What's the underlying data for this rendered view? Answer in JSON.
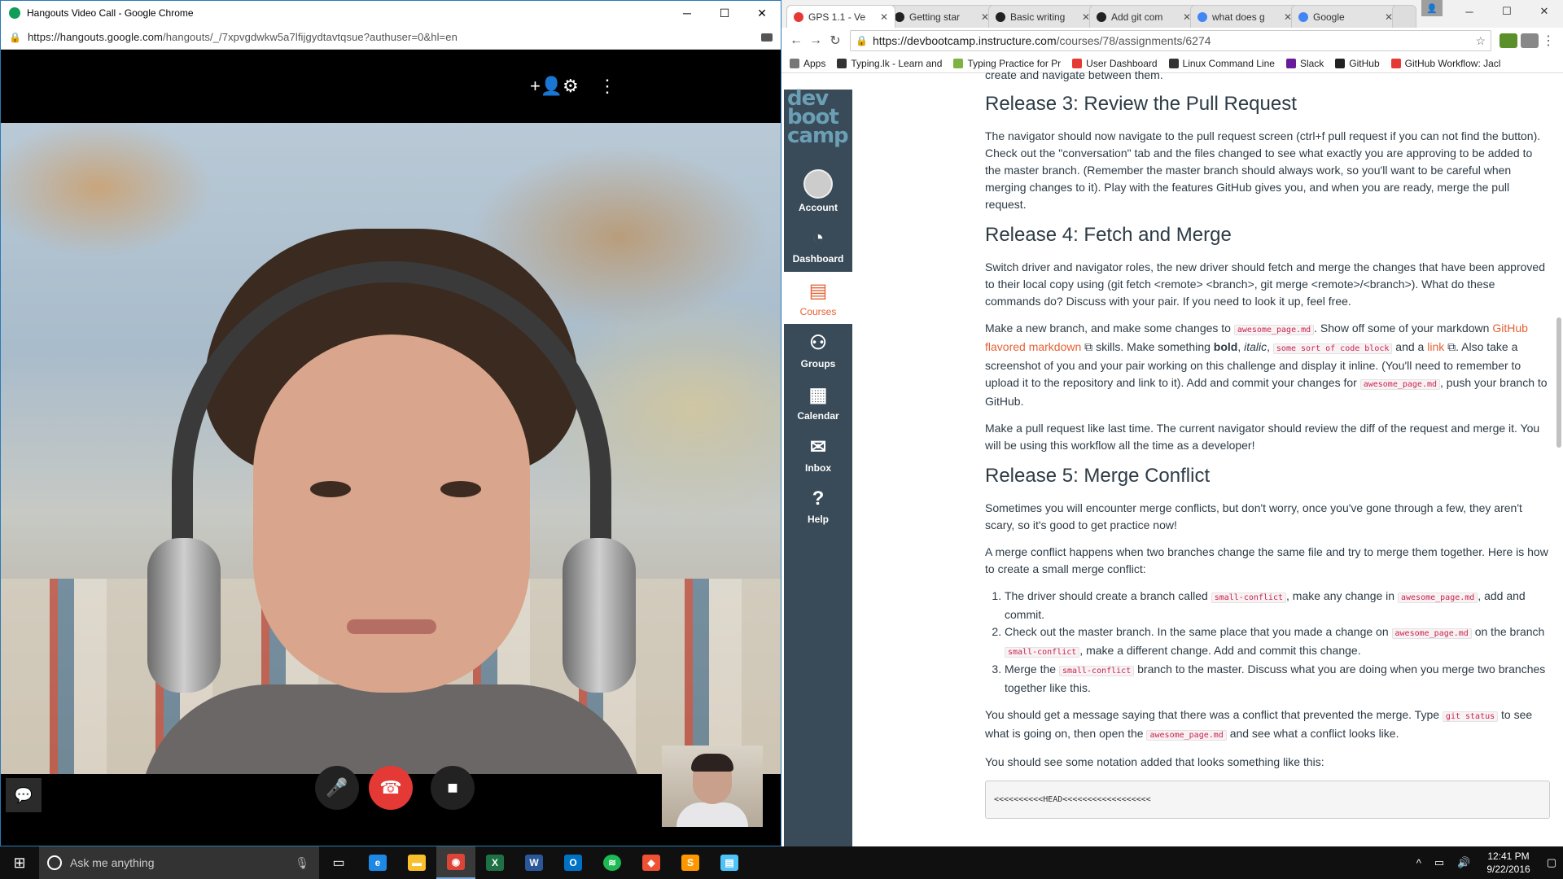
{
  "hangouts": {
    "window_title": "Hangouts Video Call - Google Chrome",
    "url_host": "https://hangouts.google.com",
    "url_path": "/hangouts/_/7xpvgdwkw5a7lfijgydtavtqsue?authuser=0&hl=en",
    "add_person_icon": "+👤",
    "settings_icon": "⚙",
    "more_icon": "⋮",
    "chat_icon": "💬",
    "mic_icon": "🎤",
    "end_call_icon": "☎",
    "camera_icon": "■"
  },
  "chrome": {
    "tabs": [
      {
        "label": "GPS 1.1 - Ve",
        "color": "#e53935"
      },
      {
        "label": "Getting star",
        "color": "#222222"
      },
      {
        "label": "Basic writing",
        "color": "#222222"
      },
      {
        "label": "Add git com",
        "color": "#222222"
      },
      {
        "label": "what does g",
        "color": "#4285f4"
      },
      {
        "label": "Google",
        "color": "#4285f4"
      }
    ],
    "url_host": "https://devbootcamp.instructure.com",
    "url_path": "/courses/78/assignments/6274",
    "bookmarks": [
      {
        "label": "Apps",
        "color": "#777777"
      },
      {
        "label": "Typing.lk - Learn and",
        "color": "#333333"
      },
      {
        "label": "Typing Practice for Pr",
        "color": "#7cb342"
      },
      {
        "label": "User Dashboard",
        "color": "#e53935"
      },
      {
        "label": "Linux Command Line",
        "color": "#333333"
      },
      {
        "label": "Slack",
        "color": "#6a1b9a"
      },
      {
        "label": "GitHub",
        "color": "#222222"
      },
      {
        "label": "GitHub Workflow: Jacl",
        "color": "#e53935"
      }
    ]
  },
  "canvas_nav": {
    "logo": [
      "dev",
      "boot",
      "camp"
    ],
    "items": [
      {
        "label": "Account",
        "icon": "◯"
      },
      {
        "label": "Dashboard",
        "icon": "◔"
      },
      {
        "label": "Courses",
        "icon": "▤"
      },
      {
        "label": "Groups",
        "icon": "⚇"
      },
      {
        "label": "Calendar",
        "icon": "▦"
      },
      {
        "label": "Inbox",
        "icon": "✉"
      },
      {
        "label": "Help",
        "icon": "?"
      }
    ]
  },
  "content": {
    "top_fragment": "create and navigate between them.",
    "r3_title": "Release 3: Review the Pull Request",
    "r3_p": "The navigator should now navigate to the pull request screen (ctrl+f pull request if you can not find the button). Check out the \"conversation\" tab and the files changed to see what exactly you are approving to be added to the master branch. (Remember the master branch should always work, so you'll want to be careful when merging changes to it). Play with the features GitHub gives you, and when you are ready, merge the pull request.",
    "r4_title": "Release 4: Fetch and Merge",
    "r4_p1": "Switch driver and navigator roles, the new driver should fetch and merge the changes that have been approved to their local copy using (git fetch <remote> <branch>, git merge <remote>/<branch>). What do these commands do? Discuss with your pair. If you need to look it up, feel free.",
    "r4_p2_a": "Make a new branch, and make some changes to",
    "file_name": "awesome_page.md",
    "r4_p2_b": ". Show off some of your markdown",
    "gfm_link": "GitHub flavored markdown",
    "r4_p2_c": "skills. Make something",
    "bold": "bold",
    "italic": "italic",
    "code_block": "some sort of code block",
    "r4_p2_d": "and a",
    "link_word": "link",
    "r4_p2_e": ". Also take a screenshot of you and your pair working on this challenge and display it inline. (You'll need to remember to upload it to the repository and link to it). Add and commit your changes for",
    "r4_p2_f": ", push your branch to GitHub.",
    "r4_p3": "Make a pull request like last time. The current navigator should review the diff of the request and merge it. You will be using this workflow all the time as a developer!",
    "r5_title": "Release 5: Merge Conflict",
    "r5_p1": "Sometimes you will encounter merge conflicts, but don't worry, once you've gone through a few, they aren't scary, so it's good to get practice now!",
    "r5_p2": "A merge conflict happens when two branches change the same file and try to merge them together. Here is how to create a small merge conflict:",
    "small_conflict": "small-conflict",
    "li1_a": "The driver should create a branch called",
    "li1_b": ", make any change in",
    "li1_c": ", add and commit.",
    "li2_a": "Check out the master branch. In the same place that you made a change on",
    "li2_b": "on the branch",
    "li2_c": ", make a different change. Add and commit this change.",
    "li3_a": "Merge the",
    "li3_b": "branch to the master. Discuss what you are doing when you merge two branches together like this.",
    "r5_p3_a": "You should get a message saying that there was a conflict that prevented the merge. Type",
    "git_status": "git status",
    "r5_p3_b": "to see what is going on, then open the",
    "r5_p3_c": "and see what a conflict looks like.",
    "r5_p4": "You should see some notation added that looks something like this:",
    "pre": "<<<<<<<<<<HEAD<<<<<<<<<<<<<<<<<<"
  },
  "taskbar": {
    "search_placeholder": "Ask me anything",
    "apps": [
      {
        "name": "task-view",
        "glyph": "▭",
        "color": "#101010"
      },
      {
        "name": "edge",
        "glyph": "e",
        "color": "#1e88e5"
      },
      {
        "name": "file-explorer",
        "glyph": "▬",
        "color": "#f9c02e"
      },
      {
        "name": "chrome",
        "glyph": "◉",
        "color": "#db4437"
      },
      {
        "name": "excel",
        "glyph": "X",
        "color": "#1e7145"
      },
      {
        "name": "word",
        "glyph": "W",
        "color": "#2b579a"
      },
      {
        "name": "outlook",
        "glyph": "O",
        "color": "#0072c6"
      },
      {
        "name": "spotify",
        "glyph": "≋",
        "color": "#1db954"
      },
      {
        "name": "git",
        "glyph": "◆",
        "color": "#f05033"
      },
      {
        "name": "sublime",
        "glyph": "S",
        "color": "#ff9800"
      },
      {
        "name": "notepad",
        "glyph": "▤",
        "color": "#4fc3f7"
      }
    ],
    "time": "12:41 PM",
    "date": "9/22/2016"
  }
}
